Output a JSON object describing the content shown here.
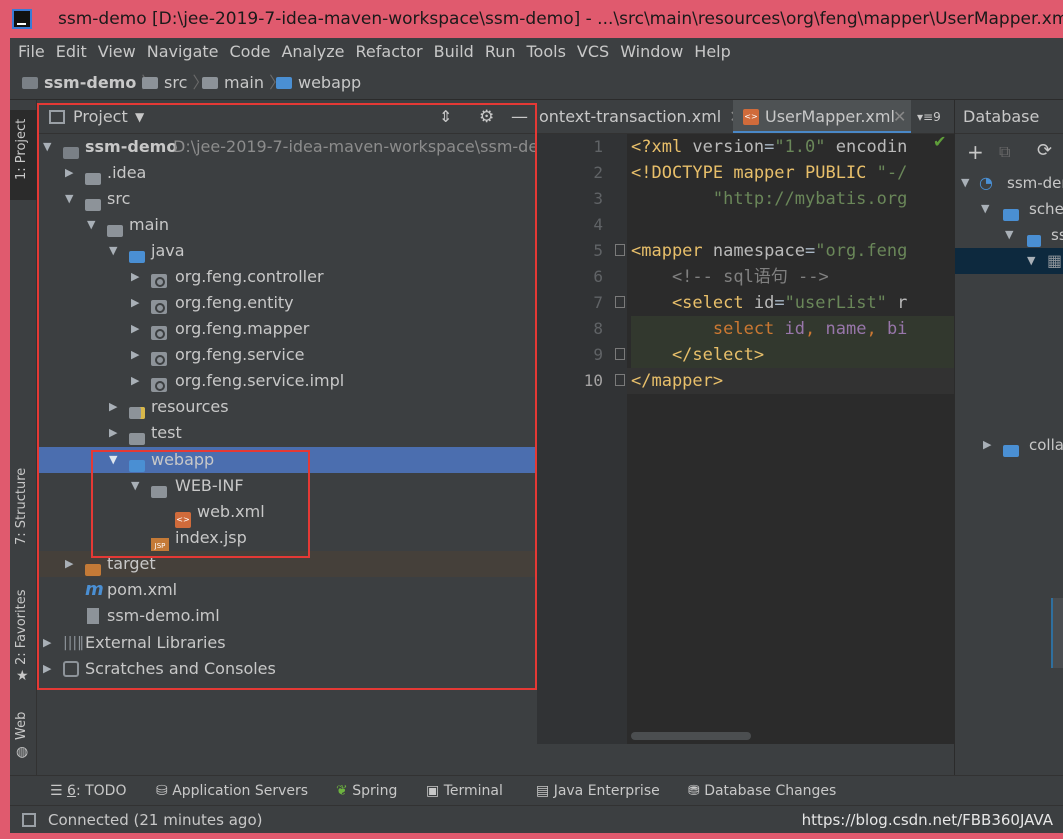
{
  "window": {
    "title": "ssm-demo [D:\\jee-2019-7-idea-maven-workspace\\ssm-demo] - ...\\src\\main\\resources\\org\\feng\\mapper\\UserMapper.xml"
  },
  "menu": [
    "File",
    "Edit",
    "View",
    "Navigate",
    "Code",
    "Analyze",
    "Refactor",
    "Build",
    "Run",
    "Tools",
    "VCS",
    "Window",
    "Help"
  ],
  "breadcrumb": [
    "ssm-demo",
    "src",
    "main",
    "webapp"
  ],
  "left_tabs": [
    "1: Project",
    "7: Structure",
    "2: Favorites",
    "Web"
  ],
  "project": {
    "header": "Project",
    "tree": [
      {
        "label": "ssm-demo",
        "path": "D:\\jee-2019-7-idea-maven-workspace\\ssm-demo"
      },
      {
        "label": ".idea"
      },
      {
        "label": "src"
      },
      {
        "label": "main"
      },
      {
        "label": "java"
      },
      {
        "label": "org.feng.controller"
      },
      {
        "label": "org.feng.entity"
      },
      {
        "label": "org.feng.mapper"
      },
      {
        "label": "org.feng.service"
      },
      {
        "label": "org.feng.service.impl"
      },
      {
        "label": "resources"
      },
      {
        "label": "test"
      },
      {
        "label": "webapp"
      },
      {
        "label": "WEB-INF"
      },
      {
        "label": "web.xml"
      },
      {
        "label": "index.jsp"
      },
      {
        "label": "target"
      },
      {
        "label": "pom.xml"
      },
      {
        "label": "ssm-demo.iml"
      },
      {
        "label": "External Libraries"
      },
      {
        "label": "Scratches and Consoles"
      }
    ]
  },
  "editor": {
    "tabs": [
      "ontext-transaction.xml",
      "UserMapper.xml"
    ],
    "tab_overflow": "9",
    "line_numbers": [
      "1",
      "2",
      "3",
      "4",
      "5",
      "6",
      "7",
      "8",
      "9",
      "10"
    ],
    "lines": [
      [
        {
          "c": "tg",
          "t": "<?xml "
        },
        {
          "c": "at",
          "t": "version"
        },
        {
          "c": "",
          "t": "="
        },
        {
          "c": "sv",
          "t": "\"1.0\""
        },
        {
          "c": "",
          "t": " "
        },
        {
          "c": "at",
          "t": "encodin"
        }
      ],
      [
        {
          "c": "tg",
          "t": "<!DOCTYPE mapper PUBLIC "
        },
        {
          "c": "sv",
          "t": "\"-/"
        }
      ],
      [
        {
          "c": "",
          "t": "        "
        },
        {
          "c": "sv",
          "t": "\"http://mybatis.org"
        }
      ],
      [
        {
          "c": "",
          "t": ""
        }
      ],
      [
        {
          "c": "tg",
          "t": "<mapper "
        },
        {
          "c": "at",
          "t": "namespace"
        },
        {
          "c": "",
          "t": "="
        },
        {
          "c": "sv",
          "t": "\"org.feng"
        }
      ],
      [
        {
          "c": "cm",
          "t": "    <!-- sql语句 -->"
        }
      ],
      [
        {
          "c": "tg",
          "t": "    <select "
        },
        {
          "c": "at",
          "t": "id"
        },
        {
          "c": "",
          "t": "="
        },
        {
          "c": "sv",
          "t": "\"userList\""
        },
        {
          "c": "",
          "t": " "
        },
        {
          "c": "at",
          "t": "r"
        }
      ],
      [
        {
          "c": "kw",
          "t": "        select "
        },
        {
          "c": "pu",
          "t": "id"
        },
        {
          "c": "kw",
          "t": ", "
        },
        {
          "c": "pu",
          "t": "name"
        },
        {
          "c": "kw",
          "t": ", "
        },
        {
          "c": "pu",
          "t": "bi"
        }
      ],
      [
        {
          "c": "tg",
          "t": "    </select>"
        }
      ],
      [
        {
          "c": "tg",
          "t": "</mapper>"
        }
      ]
    ]
  },
  "database": {
    "header": "Database",
    "tree": [
      "ssm-der",
      "schei",
      "ss",
      "colla"
    ]
  },
  "bottom_tools": [
    {
      "num": "6",
      "label": ": TODO"
    },
    {
      "label": "Application Servers"
    },
    {
      "label": "Spring"
    },
    {
      "label": "Terminal"
    },
    {
      "label": "Java Enterprise"
    },
    {
      "label": "Database Changes"
    }
  ],
  "status": {
    "text": "Connected (21 minutes ago)",
    "watermark": "https://blog.csdn.net/FBB360JAVA"
  }
}
